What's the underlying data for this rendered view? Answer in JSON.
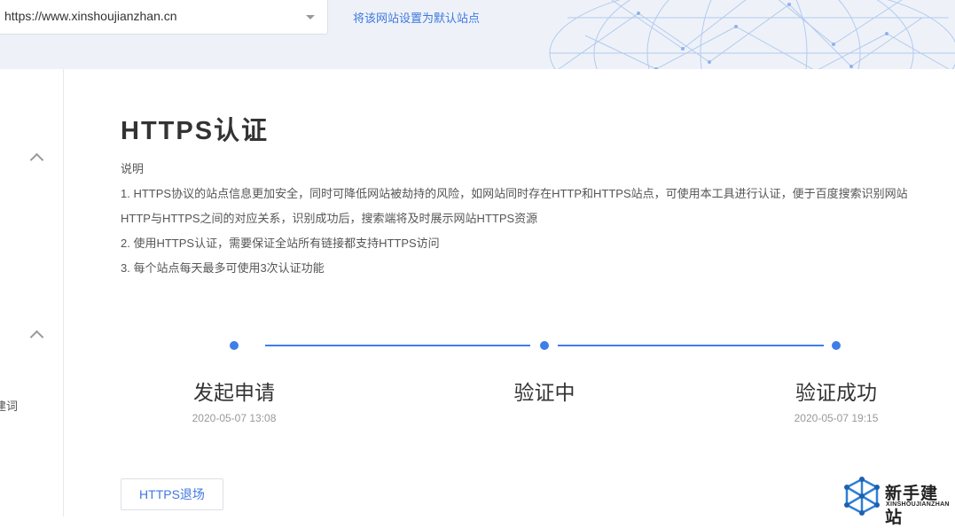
{
  "header": {
    "site_url": "https://www.xinshoujianzhan.cn",
    "set_default_link": "将该网站设置为默认站点"
  },
  "sidebar": {
    "partial_label": "建词"
  },
  "main": {
    "title": "HTTPS认证",
    "description": [
      "说明",
      "1. HTTPS协议的站点信息更加安全，同时可降低网站被劫持的风险，如网站同时存在HTTP和HTTPS站点，可使用本工具进行认证，便于百度搜索识别网站",
      "HTTP与HTTPS之间的对应关系，识别成功后，搜索端将及时展示网站HTTPS资源",
      "2. 使用HTTPS认证，需要保证全站所有链接都支持HTTPS访问",
      "3. 每个站点每天最多可使用3次认证功能"
    ],
    "steps": [
      {
        "name": "发起申请",
        "time": "2020-05-07 13:08"
      },
      {
        "name": "验证中",
        "time": ""
      },
      {
        "name": "验证成功",
        "time": "2020-05-07 19:15"
      }
    ],
    "exit_button": "HTTPS退场"
  },
  "watermark": {
    "cn": "新手建站",
    "en": "XINSHOUJIANZHAN"
  },
  "colors": {
    "accent": "#3f7ee8",
    "link": "#3f78e0",
    "banner_bg": "#eef2f8"
  },
  "icons": [
    "chevron-up-icon",
    "dropdown-caret-icon",
    "site-logo-icon"
  ]
}
